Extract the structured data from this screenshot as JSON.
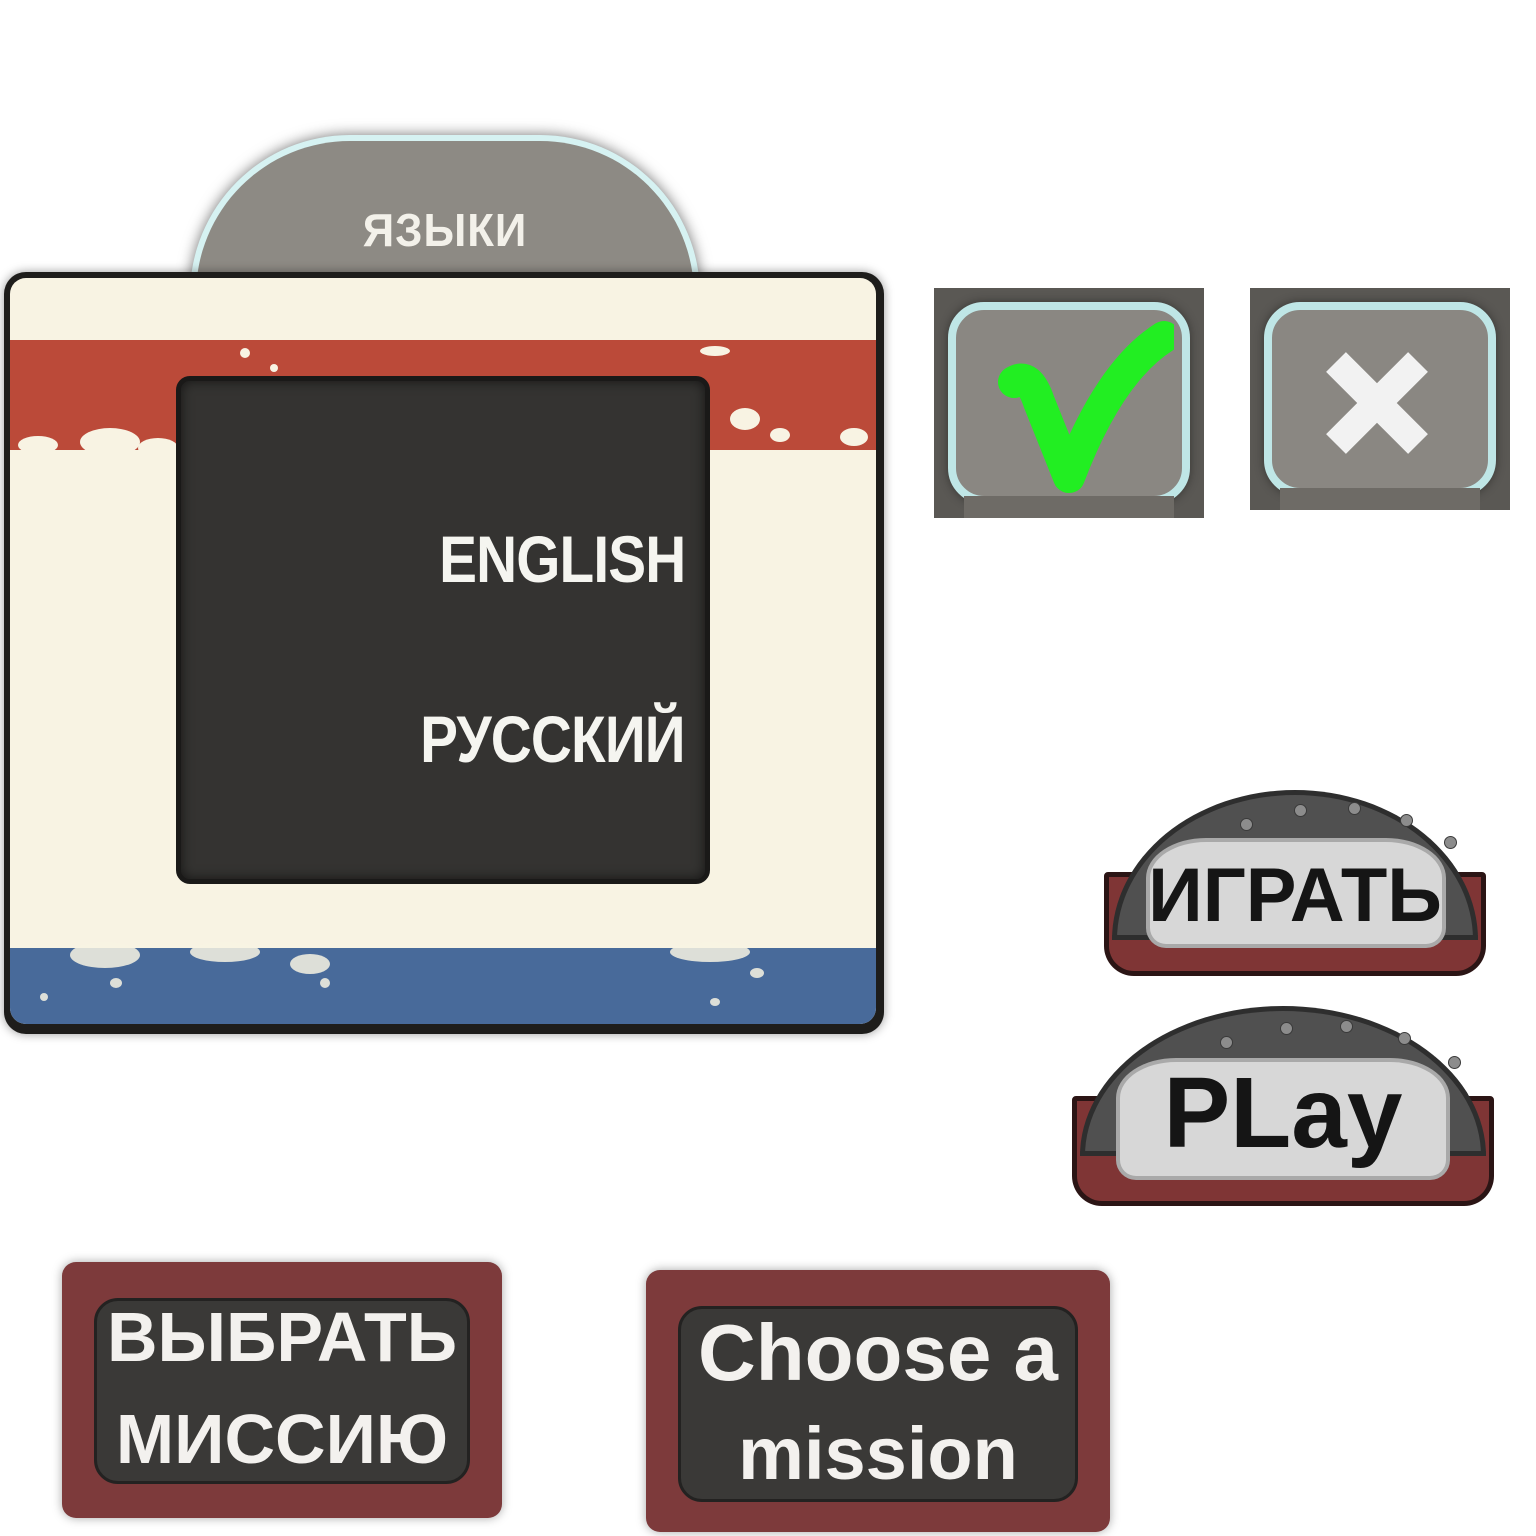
{
  "language_panel": {
    "title": "ЯЗЫКИ",
    "options": [
      "ENGLISH",
      "РУССКИЙ"
    ]
  },
  "confirm_buttons": {
    "confirm_icon": "check-icon",
    "cancel_icon": "close-icon",
    "check_color": "#22ee22",
    "cross_color": "#f2f2f2"
  },
  "play_buttons": {
    "russian": "ИГРАТЬ",
    "english": "PLay"
  },
  "mission_buttons": {
    "russian_line1": "ВЫБРАТЬ",
    "russian_line2": "МИССИЮ",
    "english_line1": "Choose a",
    "english_line2": "mission"
  },
  "colors": {
    "flag_red": "#bb4a39",
    "flag_white": "#f8f3e3",
    "flag_blue": "#486a9a",
    "panel_dark": "#343331",
    "button_red": "#7d3a3b"
  }
}
